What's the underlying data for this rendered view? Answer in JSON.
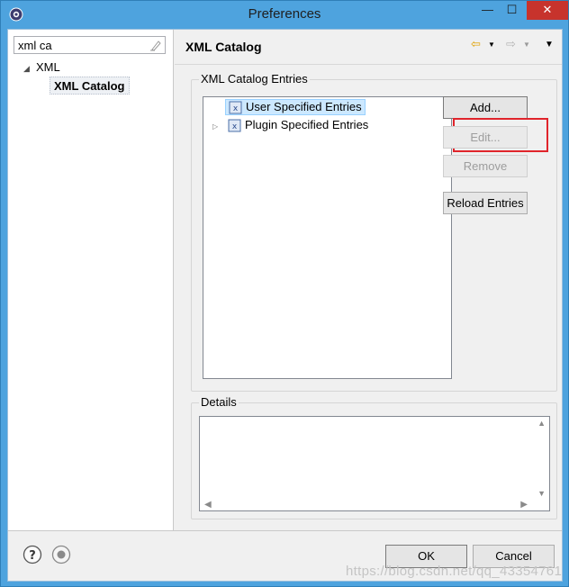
{
  "window": {
    "title": "Preferences",
    "controls": {
      "minimize": "—",
      "maximize": "☐",
      "close": "✕"
    }
  },
  "nav": {
    "filter_value": "xml ca",
    "tree": {
      "parent_label": "XML",
      "child_label": "XML Catalog"
    }
  },
  "page": {
    "title": "XML Catalog",
    "catalog_group_label": "XML Catalog Entries",
    "entries": [
      "User Specified Entries",
      "Plugin Specified Entries"
    ],
    "buttons": {
      "add": "Add...",
      "edit": "Edit...",
      "remove": "Remove",
      "reload": "Reload Entries"
    },
    "details_label": "Details"
  },
  "footer": {
    "ok": "OK",
    "cancel": "Cancel",
    "watermark": "https://blog.csdn.net/qq_43354761"
  },
  "colors": {
    "title_bar": "#4ea3de",
    "close_button": "#c7332c",
    "selection": "#cce8ff",
    "highlight_box": "#e0242b"
  },
  "icons": {
    "app": "eclipse-gear-icon",
    "filter_clear": "clear-filter-icon",
    "back": "back-arrow-icon",
    "forward": "forward-arrow-icon",
    "menu": "view-menu-icon",
    "entry": "xml-catalog-icon",
    "help": "help-icon",
    "record": "record-icon"
  }
}
